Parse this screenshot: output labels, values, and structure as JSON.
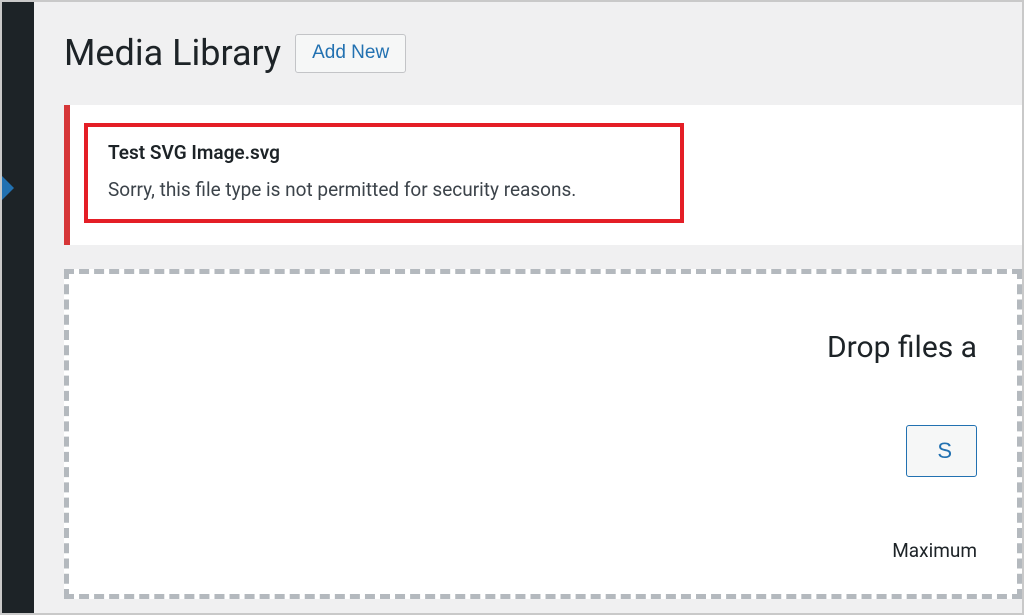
{
  "header": {
    "page_title": "Media Library",
    "add_new_label": "Add New"
  },
  "notice": {
    "filename": "Test SVG Image.svg",
    "message": "Sorry, this file type is not permitted for security reasons."
  },
  "dropzone": {
    "drop_text": "Drop files a",
    "select_label": "S",
    "max_text": "Maximum"
  }
}
